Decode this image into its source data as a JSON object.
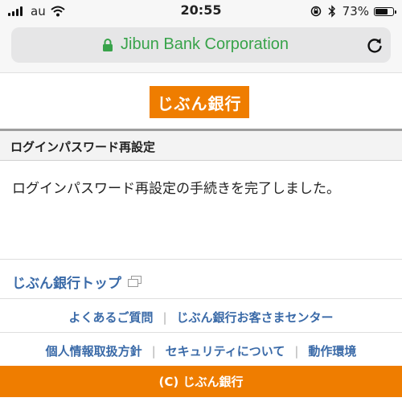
{
  "status_bar": {
    "carrier": "au",
    "time": "20:55",
    "battery": "73%",
    "battery_level": 0.73
  },
  "browser": {
    "site_label": "Jibun Bank Corporation",
    "accent_color": "#38a34a"
  },
  "page": {
    "logo_text": "じぶん銀行",
    "section_title": "ログインパスワード再設定",
    "message": "ログインパスワード再設定の手続きを完了しました。",
    "top_link": "じぶん銀行トップ",
    "links_row1": [
      "よくあるご質問",
      "じぶん銀行お客さまセンター"
    ],
    "links_row2": [
      "個人情報取扱方針",
      "セキュリティについて",
      "動作環境"
    ],
    "footer": "(C) じぶん銀行",
    "brand_color": "#ef7d00",
    "link_color": "#3a6aa8"
  }
}
